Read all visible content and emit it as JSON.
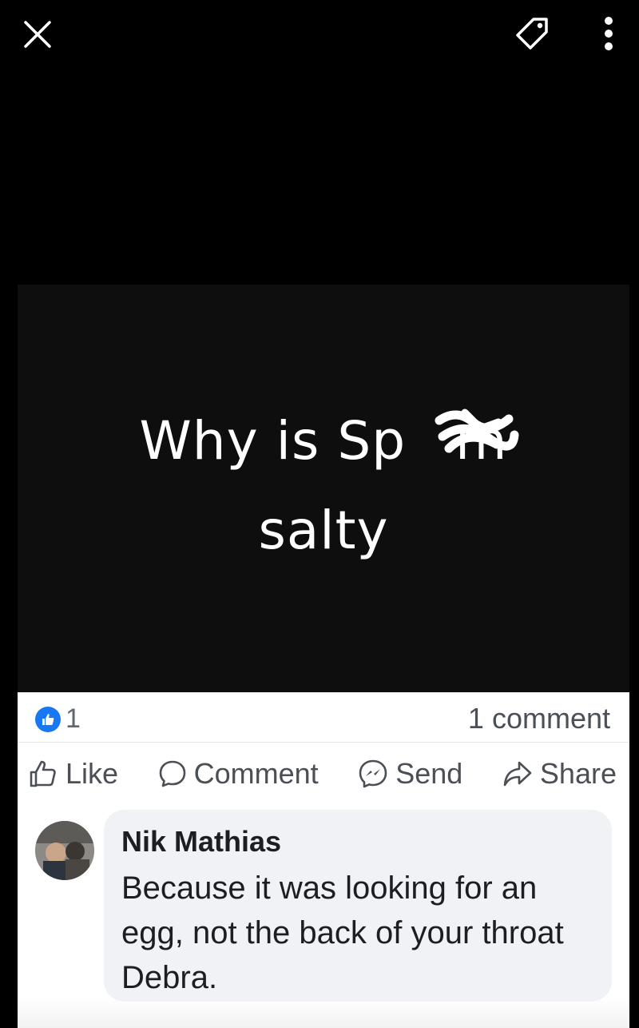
{
  "viewer": {
    "close_icon": "close-icon",
    "tag_icon": "tag-icon",
    "more_icon": "more-vertical-icon"
  },
  "post": {
    "image_text_line1": "Why is Sp",
    "image_text_line1_end": "m",
    "image_text_line2": "salty",
    "reaction_count": "1",
    "comment_count": "1 comment",
    "colors": {
      "like_blue": "#1877f2",
      "text_gray": "#4b4f56",
      "bubble_bg": "#f0f2f5"
    }
  },
  "actions": {
    "like_label": "Like",
    "comment_label": "Comment",
    "send_label": "Send",
    "share_label": "Share"
  },
  "comment": {
    "author": "Nik Mathias",
    "text": "Because it was looking for an egg, not the back of your throat Debra."
  }
}
